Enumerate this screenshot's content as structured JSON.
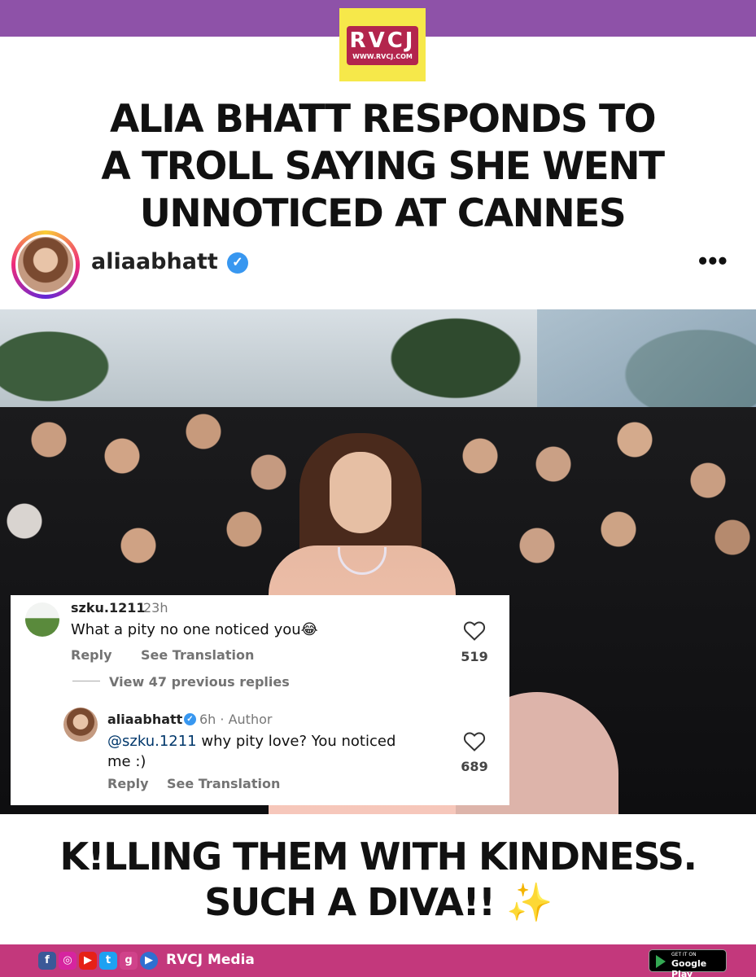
{
  "brand": {
    "logo_text": "RVCJ",
    "logo_url": "WWW.RVCJ.COM"
  },
  "headline": {
    "line1": "ALIA BHATT RESPONDS TO",
    "line2": "A TROLL SAYING SHE WENT",
    "line3": "UNNOTICED AT CANNES"
  },
  "post": {
    "username": "aliaabhatt",
    "verified_glyph": "✓",
    "more_label": "•••"
  },
  "comments": {
    "original": {
      "username": "szku.1211",
      "time": "23h",
      "text": "What a pity no one noticed you",
      "emoji": "😂",
      "reply_label": "Reply",
      "translate_label": "See Translation",
      "likes": "519"
    },
    "view_replies_label": "View 47 previous replies",
    "reply": {
      "username": "aliaabhatt",
      "verified_glyph": "✓",
      "meta": "6h · Author",
      "mention": "@szku.1211",
      "text_after_mention": " why pity love? You noticed",
      "text_line2": "me :)",
      "reply_label": "Reply",
      "translate_label": "See Translation",
      "likes": "689"
    }
  },
  "tagline": {
    "line1": "K!LLING THEM WITH KINDNESS.",
    "line2": "SUCH A DIVA!! ",
    "sparkle": "✨"
  },
  "footer": {
    "social_icons": [
      "facebook-icon",
      "instagram-icon",
      "youtube-icon",
      "twitter-icon",
      "gplus-icon",
      "play-icon"
    ],
    "fb": "f",
    "ig": "◎",
    "yt": "▶",
    "tw": "t",
    "gp": "g",
    "play": "▶",
    "brand_name": "RVCJ Media",
    "store_small": "GET IT ON",
    "store_big": "Google Play"
  },
  "colors": {
    "top_bar": "#8e52a8",
    "logo_bg": "#f6e84a",
    "logo_red": "#b3254d",
    "footer": "#c3387c",
    "verified_blue": "#3897f0"
  }
}
